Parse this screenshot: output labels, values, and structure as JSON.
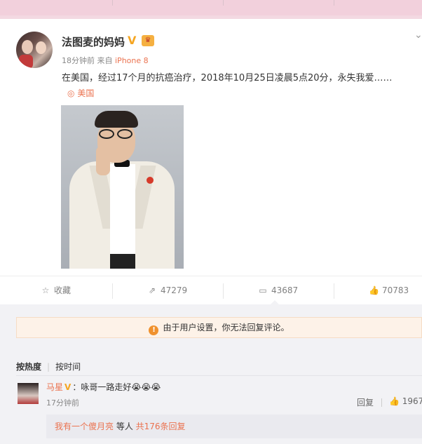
{
  "post": {
    "username": "法图麦的妈妈",
    "verified_badge": "V",
    "time": "18分钟前",
    "source_prefix": "来自",
    "source": "iPhone 8",
    "text": "在美国，经过17个月的抗癌治疗，2018年10月25日凌晨5点20分，永失我爱……",
    "location": "美国",
    "menu_icon": "chevron-down-icon"
  },
  "actions": {
    "favorite": {
      "label": "收藏",
      "icon": "star-icon"
    },
    "repost": {
      "count": "47279",
      "icon": "share-icon"
    },
    "comment": {
      "count": "43687",
      "icon": "comment-icon"
    },
    "like": {
      "count": "70783",
      "icon": "thumb-up-icon"
    }
  },
  "notice": {
    "text": "由于用户设置，你无法回复评论。",
    "icon": "warning-icon"
  },
  "sort": {
    "by_hot": "按热度",
    "by_time": "按时间"
  },
  "comments": [
    {
      "name": "马星",
      "badge": "V",
      "text": "：咏哥一路走好😭😭😭",
      "time": "17分钟前",
      "reply_label": "回复",
      "likes": "1967",
      "sub_reply": {
        "name": "我有一个傻月亮",
        "middle": " 等人 ",
        "count_text": "共176条回复"
      }
    }
  ],
  "colors": {
    "accent": "#eb7350",
    "verified": "#f5a623",
    "warning": "#f0912d",
    "page_bg": "#f2f2f5"
  }
}
